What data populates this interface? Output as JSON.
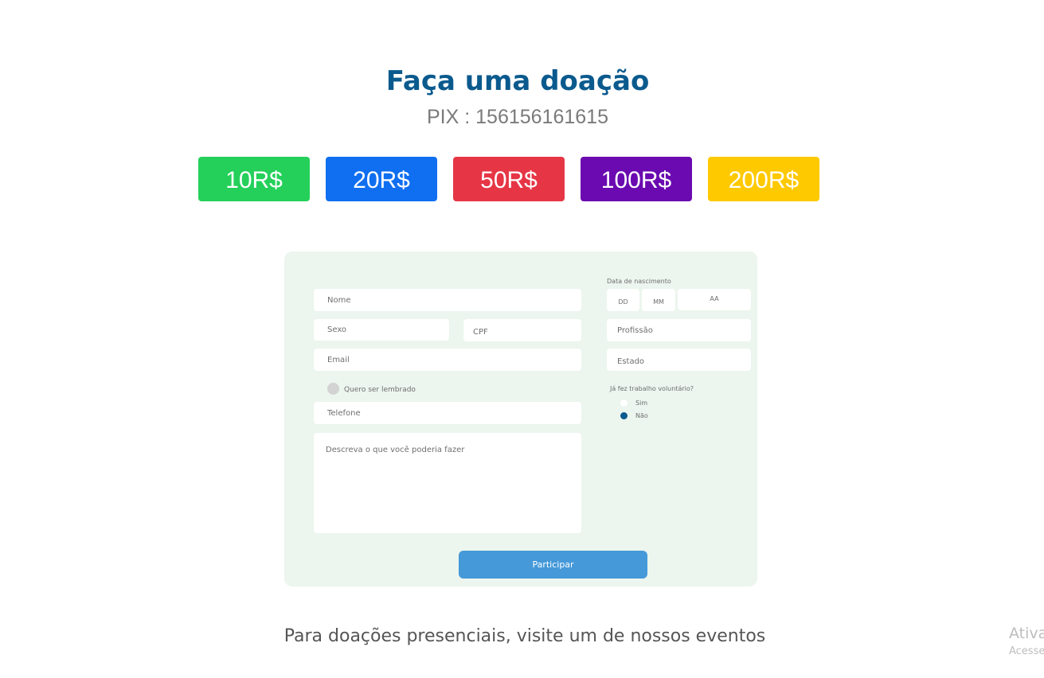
{
  "header": {
    "title": "Faça uma doação",
    "pix": "PIX : 156156161615"
  },
  "amounts": [
    {
      "label": "10R$",
      "color": "#24d05a"
    },
    {
      "label": "20R$",
      "color": "#0f6ff0"
    },
    {
      "label": "50R$",
      "color": "#e63645"
    },
    {
      "label": "100R$",
      "color": "#6a0ab0"
    },
    {
      "label": "200R$",
      "color": "#ffc900"
    }
  ],
  "form": {
    "nome": "Nome",
    "sexo": "Sexo",
    "cpf": "CPF",
    "email": "Email",
    "remember": "Quero ser lembrado",
    "telefone": "Telefone",
    "descricao": "Descreva o que você poderia fazer",
    "birth_label": "Data de nascimento",
    "dd": "DD",
    "mm": "MM",
    "aa": "AA",
    "profissao": "Profissão",
    "estado": "Estado",
    "volunteer_q": "Já fez trabalho voluntário?",
    "sim": "Sim",
    "nao": "Não",
    "volunteer_selected": "Não",
    "submit": "Participar"
  },
  "footer": "Para doações presenciais, visite um de nossos eventos",
  "watermark": {
    "line1": "Ativa",
    "line2": "Acesse"
  },
  "colors": {
    "brand": "#0b5a8e",
    "form_bg": "#ecf5ee",
    "button": "#4599d9"
  }
}
